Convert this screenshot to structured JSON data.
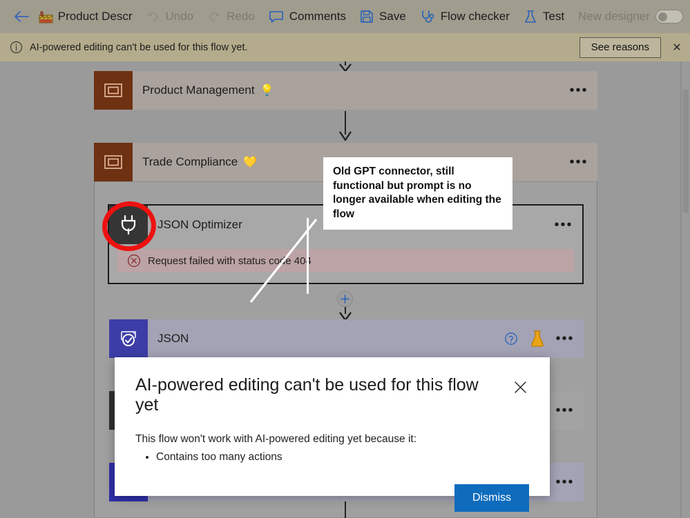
{
  "commandbar": {
    "back_label": "back-arrow",
    "flow_icon": "factory-emoji",
    "flow_title": "Product Descr",
    "buttons": [
      {
        "label": "Undo",
        "icon": "undo-icon",
        "disabled": true
      },
      {
        "label": "Redo",
        "icon": "redo-icon",
        "disabled": true
      },
      {
        "label": "Comments",
        "icon": "comment-icon",
        "disabled": false
      },
      {
        "label": "Save",
        "icon": "save-icon",
        "disabled": false
      },
      {
        "label": "Flow checker",
        "icon": "stethoscope-icon",
        "disabled": false
      },
      {
        "label": "Test",
        "icon": "flask-icon",
        "disabled": false
      }
    ],
    "toggle_label": "New designer",
    "toggle_state": "off"
  },
  "banner": {
    "icon": "info-icon",
    "message": "AI-powered editing can't be used for this flow yet.",
    "action_label": "See reasons",
    "close_label": "✕"
  },
  "canvas": {
    "nodes": [
      {
        "title": "Product Management",
        "emoji": "💡",
        "icon": "scope-icon",
        "menu": "•••",
        "type": "scope"
      },
      {
        "title": "Trade Compliance",
        "emoji": "💛",
        "icon": "scope-icon",
        "menu": "•••",
        "type": "scope"
      },
      {
        "title": "JSON Optimizer",
        "emoji": "",
        "icon": "plug-icon",
        "menu": "•••",
        "type": "action-selected",
        "error": "Request failed with status code 404",
        "error_icon": "error-circle-icon"
      },
      {
        "title": "JSON",
        "emoji": "",
        "icon": "parse-json-icon",
        "menu": "•••",
        "type": "action",
        "help_icon": "help-circle-icon",
        "test_icon": "flask-icon"
      },
      {
        "title": "",
        "emoji": "",
        "icon": "dark-connector-icon",
        "menu": "•••",
        "type": "action-hidden"
      },
      {
        "title": "",
        "emoji": "",
        "icon": "blue-connector-icon",
        "menu": "•••",
        "type": "action-hidden"
      }
    ],
    "add_step_label": "+"
  },
  "annotation": {
    "text": "Old GPT connector, still functional but prompt is no longer available when editing the flow",
    "highlight_target": "plug-icon",
    "highlight_color": "#ee1111"
  },
  "modal": {
    "title": "AI-powered editing can't be used for this flow yet",
    "close_label": "✕",
    "subtitle": "This flow won't work with AI-powered editing yet because it:",
    "reasons": [
      "Contains too many actions"
    ],
    "primary_label": "Dismiss",
    "primary_color": "#0f6cbd"
  }
}
